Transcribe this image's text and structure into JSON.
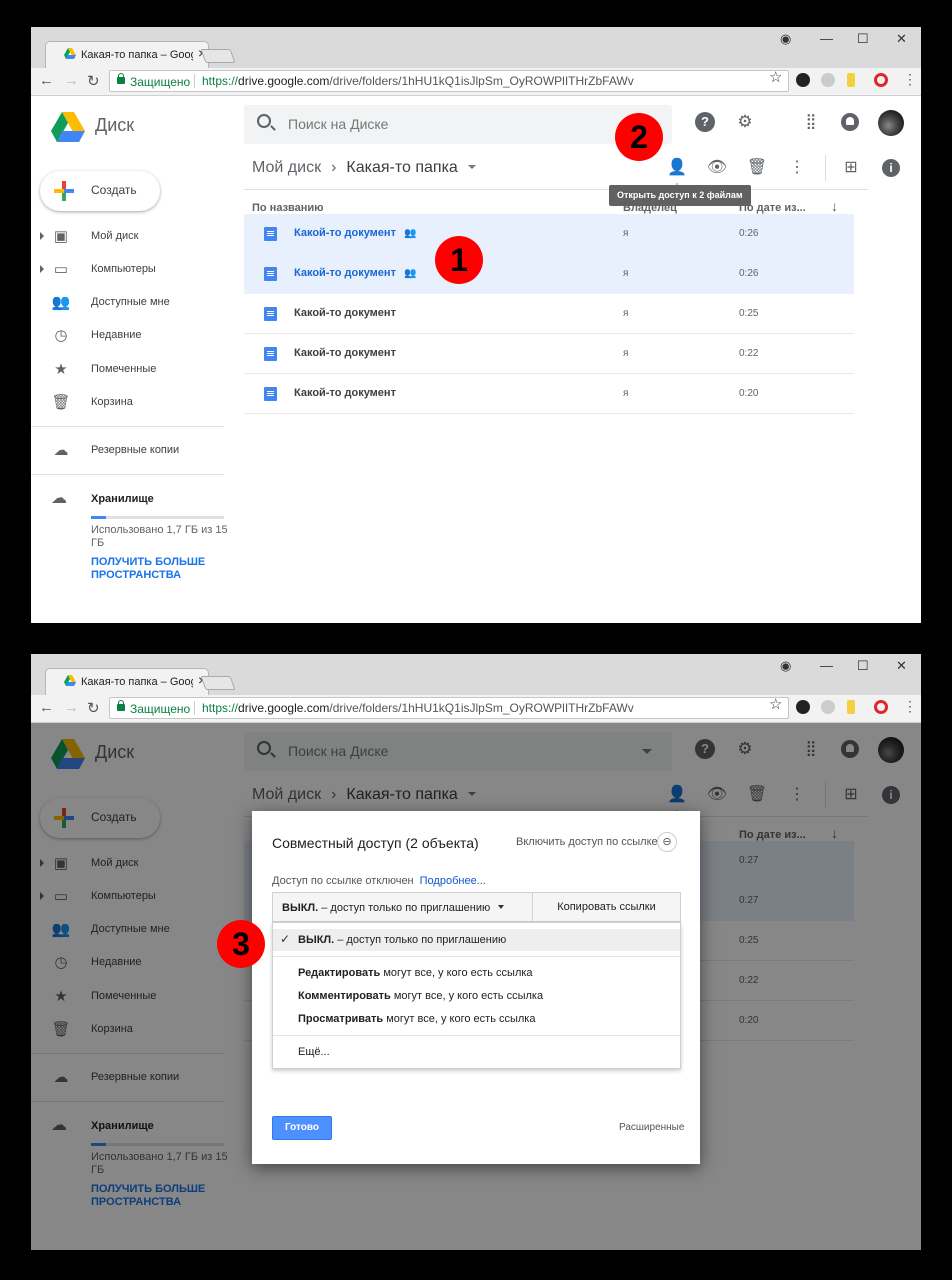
{
  "browser": {
    "tab_title": "Какая-то папка – Google Д",
    "secure_label": "Защищено",
    "url_scheme": "https://",
    "url_domain": "drive.google.com",
    "url_path": "/drive/folders/1hHU1kQ1isJlpSm_OyROWPlITHrZbFAWv"
  },
  "app": {
    "title": "Диск",
    "search_placeholder": "Поиск на Диске",
    "breadcrumb_root": "Мой диск",
    "breadcrumb_current": "Какая-то папка",
    "share_tooltip": "Открыть доступ к 2 файлам"
  },
  "sidebar": {
    "create_label": "Создать",
    "items": [
      {
        "label": "Мой диск",
        "icon": "drive-icon"
      },
      {
        "label": "Компьютеры",
        "icon": "computers-icon"
      },
      {
        "label": "Доступные мне",
        "icon": "people-icon"
      },
      {
        "label": "Недавние",
        "icon": "clock-icon"
      },
      {
        "label": "Помеченные",
        "icon": "star-icon"
      },
      {
        "label": "Корзина",
        "icon": "trash-icon"
      }
    ],
    "backups_label": "Резервные копии",
    "storage_label": "Хранилище",
    "storage_used": "Использовано 1,7 ГБ из 15 ГБ",
    "storage_fraction": 0.113,
    "get_more": "ПОЛУЧИТЬ БОЛЬШЕ ПРОСТРАНСТВА"
  },
  "columns": {
    "name": "По названию",
    "owner": "Владелец",
    "date": "По дате из..."
  },
  "files_shot1": [
    {
      "name": "Какой-то документ",
      "owner": "я",
      "date": "0:26",
      "selected": true,
      "shared": true
    },
    {
      "name": "Какой-то документ",
      "owner": "я",
      "date": "0:26",
      "selected": true,
      "shared": true
    },
    {
      "name": "Какой-то документ",
      "owner": "я",
      "date": "0:25",
      "selected": false,
      "shared": false
    },
    {
      "name": "Какой-то документ",
      "owner": "я",
      "date": "0:22",
      "selected": false,
      "shared": false
    },
    {
      "name": "Какой-то документ",
      "owner": "я",
      "date": "0:20",
      "selected": false,
      "shared": false
    }
  ],
  "files_shot2": [
    {
      "date": "0:27",
      "selected": true
    },
    {
      "date": "0:27",
      "selected": true
    },
    {
      "date": "0:25",
      "selected": false
    },
    {
      "date": "0:22",
      "selected": false
    },
    {
      "date": "0:20",
      "selected": false
    }
  ],
  "dialog": {
    "title": "Совместный доступ (2 объекта)",
    "enable_link": "Включить доступ по ссылке",
    "status": "Доступ по ссылке отключен",
    "more_link": "Подробнее...",
    "selected_bold": "ВЫКЛ.",
    "selected_rest": " – доступ только по приглашению",
    "copy_links": "Копировать ссылки",
    "options": [
      {
        "bold": "ВЫКЛ.",
        "rest": " – доступ только по приглашению",
        "checked": true
      },
      {
        "bold": "Редактировать",
        "rest": " могут все, у кого есть ссылка",
        "checked": false
      },
      {
        "bold": "Комментировать",
        "rest": " могут все, у кого есть ссылка",
        "checked": false
      },
      {
        "bold": "Просматривать",
        "rest": " могут все, у кого есть ссылка",
        "checked": false
      }
    ],
    "more": "Ещё...",
    "done": "Готово",
    "advanced": "Расширенные"
  },
  "markers": {
    "m1": "1",
    "m2": "2",
    "m3": "3"
  },
  "colors": {
    "accent": "#4285f4",
    "selected_row": "#e8f0fe",
    "secure": "#0b8043",
    "marker": "#ff0000"
  }
}
